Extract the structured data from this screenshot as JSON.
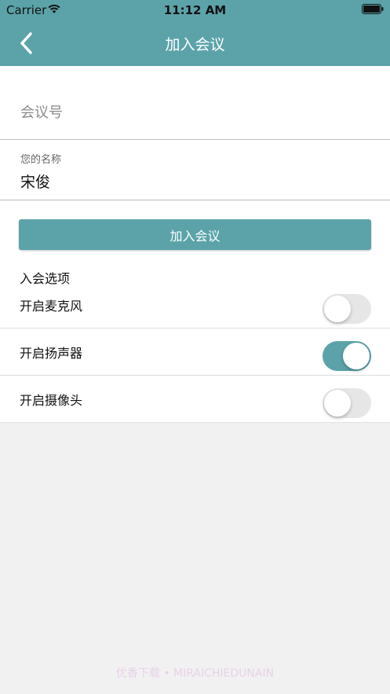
{
  "status_bar": {
    "carrier": "Carrier",
    "time": "11:12 AM",
    "wifi_icon": "wifi-icon",
    "battery_icon": "battery-icon"
  },
  "nav": {
    "title": "加入会议",
    "back_icon": "chevron-left-icon"
  },
  "form": {
    "meeting_id": {
      "placeholder": "会议号",
      "value": ""
    },
    "name": {
      "label": "您的名称",
      "value": "宋俊"
    }
  },
  "join_button": {
    "label": "加入会议"
  },
  "options": {
    "title": "入会选项",
    "items": [
      {
        "label": "开启麦克风",
        "enabled": false
      },
      {
        "label": "开启扬声器",
        "enabled": true
      },
      {
        "label": "开启摄像头",
        "enabled": false
      }
    ]
  },
  "colors": {
    "accent": "#5ba3a9",
    "toggle_off": "#e6e6e6",
    "background": "#f1f1f1"
  },
  "watermark": "优香下载 • MIRAICHIEDUNAIN"
}
